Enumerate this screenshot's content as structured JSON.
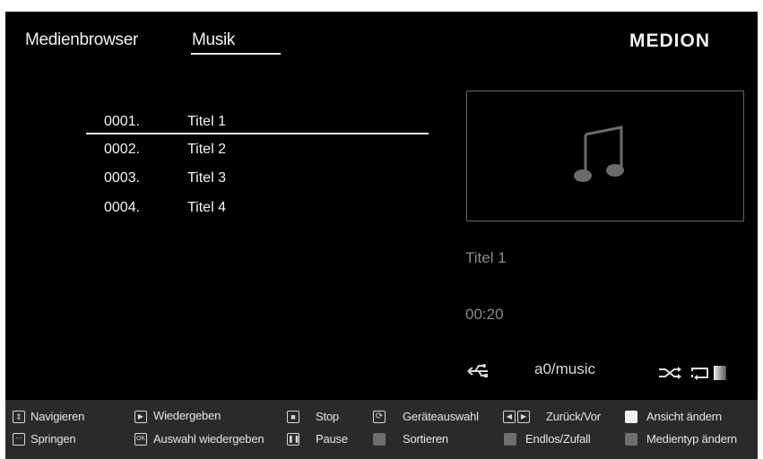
{
  "header": {
    "tab_1": "Medienbrowser",
    "tab_2": "Musik",
    "logo": "MEDION"
  },
  "tracks": [
    {
      "num": "0001.",
      "title": "Titel 1"
    },
    {
      "num": "0002.",
      "title": "Titel 2"
    },
    {
      "num": "0003.",
      "title": "Titel 3"
    },
    {
      "num": "0004.",
      "title": "Titel 4"
    }
  ],
  "now_playing": {
    "title": "Titel 1",
    "time": "00:20",
    "path": "a0/music"
  },
  "footer": {
    "navigate": "Navigieren",
    "jump": "Springen",
    "play": "Wiedergeben",
    "play_selection": "Auswahl wiedergeben",
    "ok_key": "OK",
    "stop": "Stop",
    "pause": "Pause",
    "device_select": "Geräteauswahl",
    "sort": "Sortieren",
    "back_forward": "Zurück/Vor",
    "loop_shuffle": "Endlos/Zufall",
    "change_view": "Ansicht ändern",
    "change_media_type": "Medientyp ändern"
  },
  "colors": {
    "background": "#000000",
    "text": "#f2f2f2",
    "muted": "#8a8a8a",
    "white_key": "#f2f2f2",
    "grey_key": "#6e6e6e"
  }
}
